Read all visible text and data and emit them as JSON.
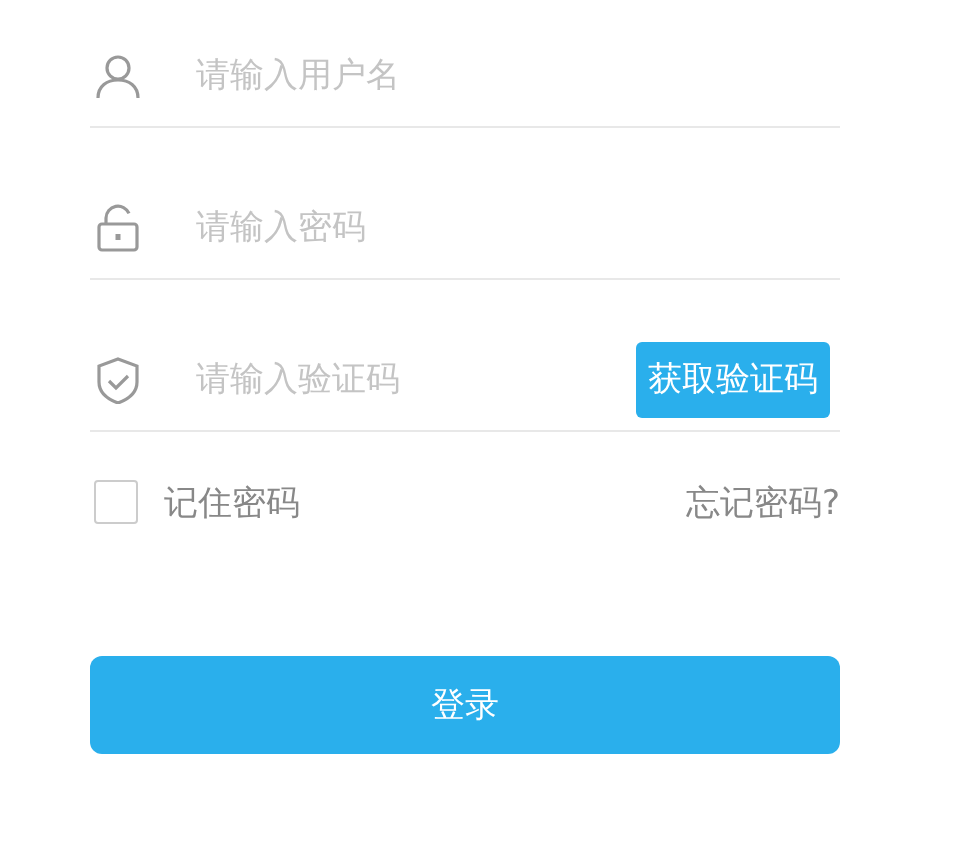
{
  "fields": [
    {
      "kind": "username",
      "placeholder": "请输入用户名"
    },
    {
      "kind": "password",
      "placeholder": "请输入密码"
    },
    {
      "kind": "code",
      "placeholder": "请输入验证码",
      "button": "获取验证码"
    }
  ],
  "remember": {
    "label": "记住密码",
    "checked": false
  },
  "forgot_link": "忘记密码?",
  "login_button": "登录"
}
